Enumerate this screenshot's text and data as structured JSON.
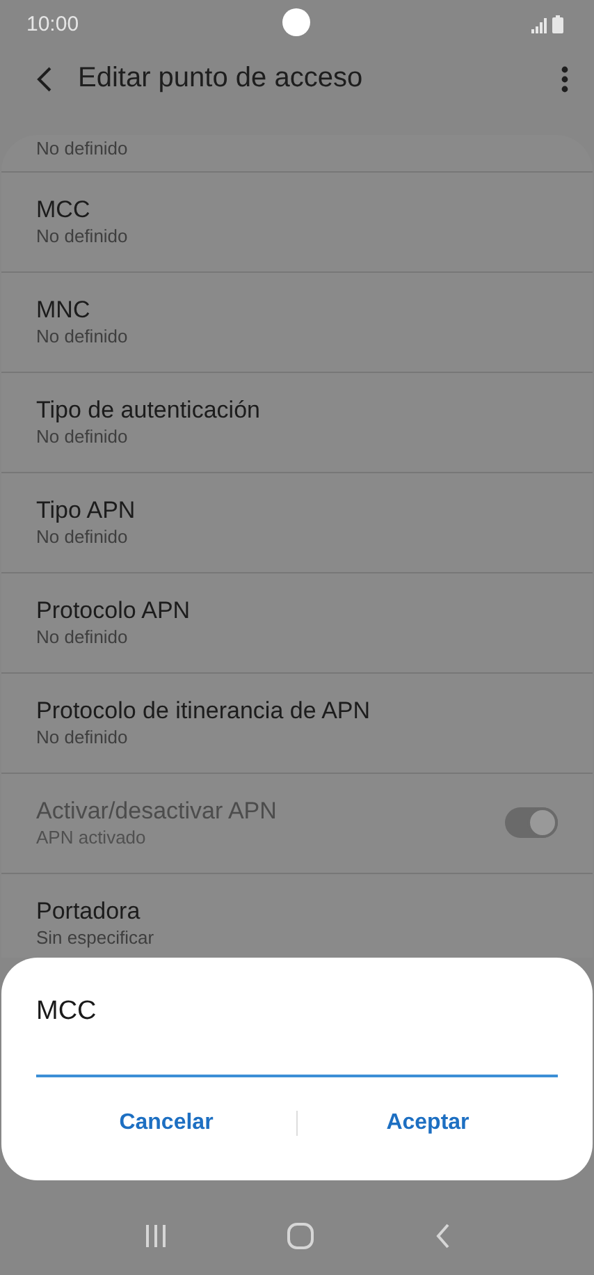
{
  "status_bar": {
    "time": "10:00"
  },
  "header": {
    "title": "Editar punto de acceso"
  },
  "settings": [
    {
      "kind": "partial",
      "subtitle": "No definido",
      "disabled": false
    },
    {
      "kind": "item",
      "title": "MCC",
      "subtitle": "No definido",
      "disabled": false
    },
    {
      "kind": "item",
      "title": "MNC",
      "subtitle": "No definido",
      "disabled": false
    },
    {
      "kind": "item",
      "title": "Tipo de autenticación",
      "subtitle": "No definido",
      "disabled": false
    },
    {
      "kind": "item",
      "title": "Tipo APN",
      "subtitle": "No definido",
      "disabled": false
    },
    {
      "kind": "item",
      "title": "Protocolo APN",
      "subtitle": "No definido",
      "disabled": false
    },
    {
      "kind": "item",
      "title": "Protocolo de itinerancia de APN",
      "subtitle": "No definido",
      "disabled": false
    },
    {
      "kind": "switch",
      "title": "Activar/desactivar APN",
      "subtitle": "APN activado",
      "disabled": true,
      "on": true
    },
    {
      "kind": "item",
      "title": "Portadora",
      "subtitle": "Sin especificar",
      "disabled": false
    }
  ],
  "dialog": {
    "title": "MCC",
    "buttons": [
      "Cancelar",
      "Aceptar"
    ]
  }
}
